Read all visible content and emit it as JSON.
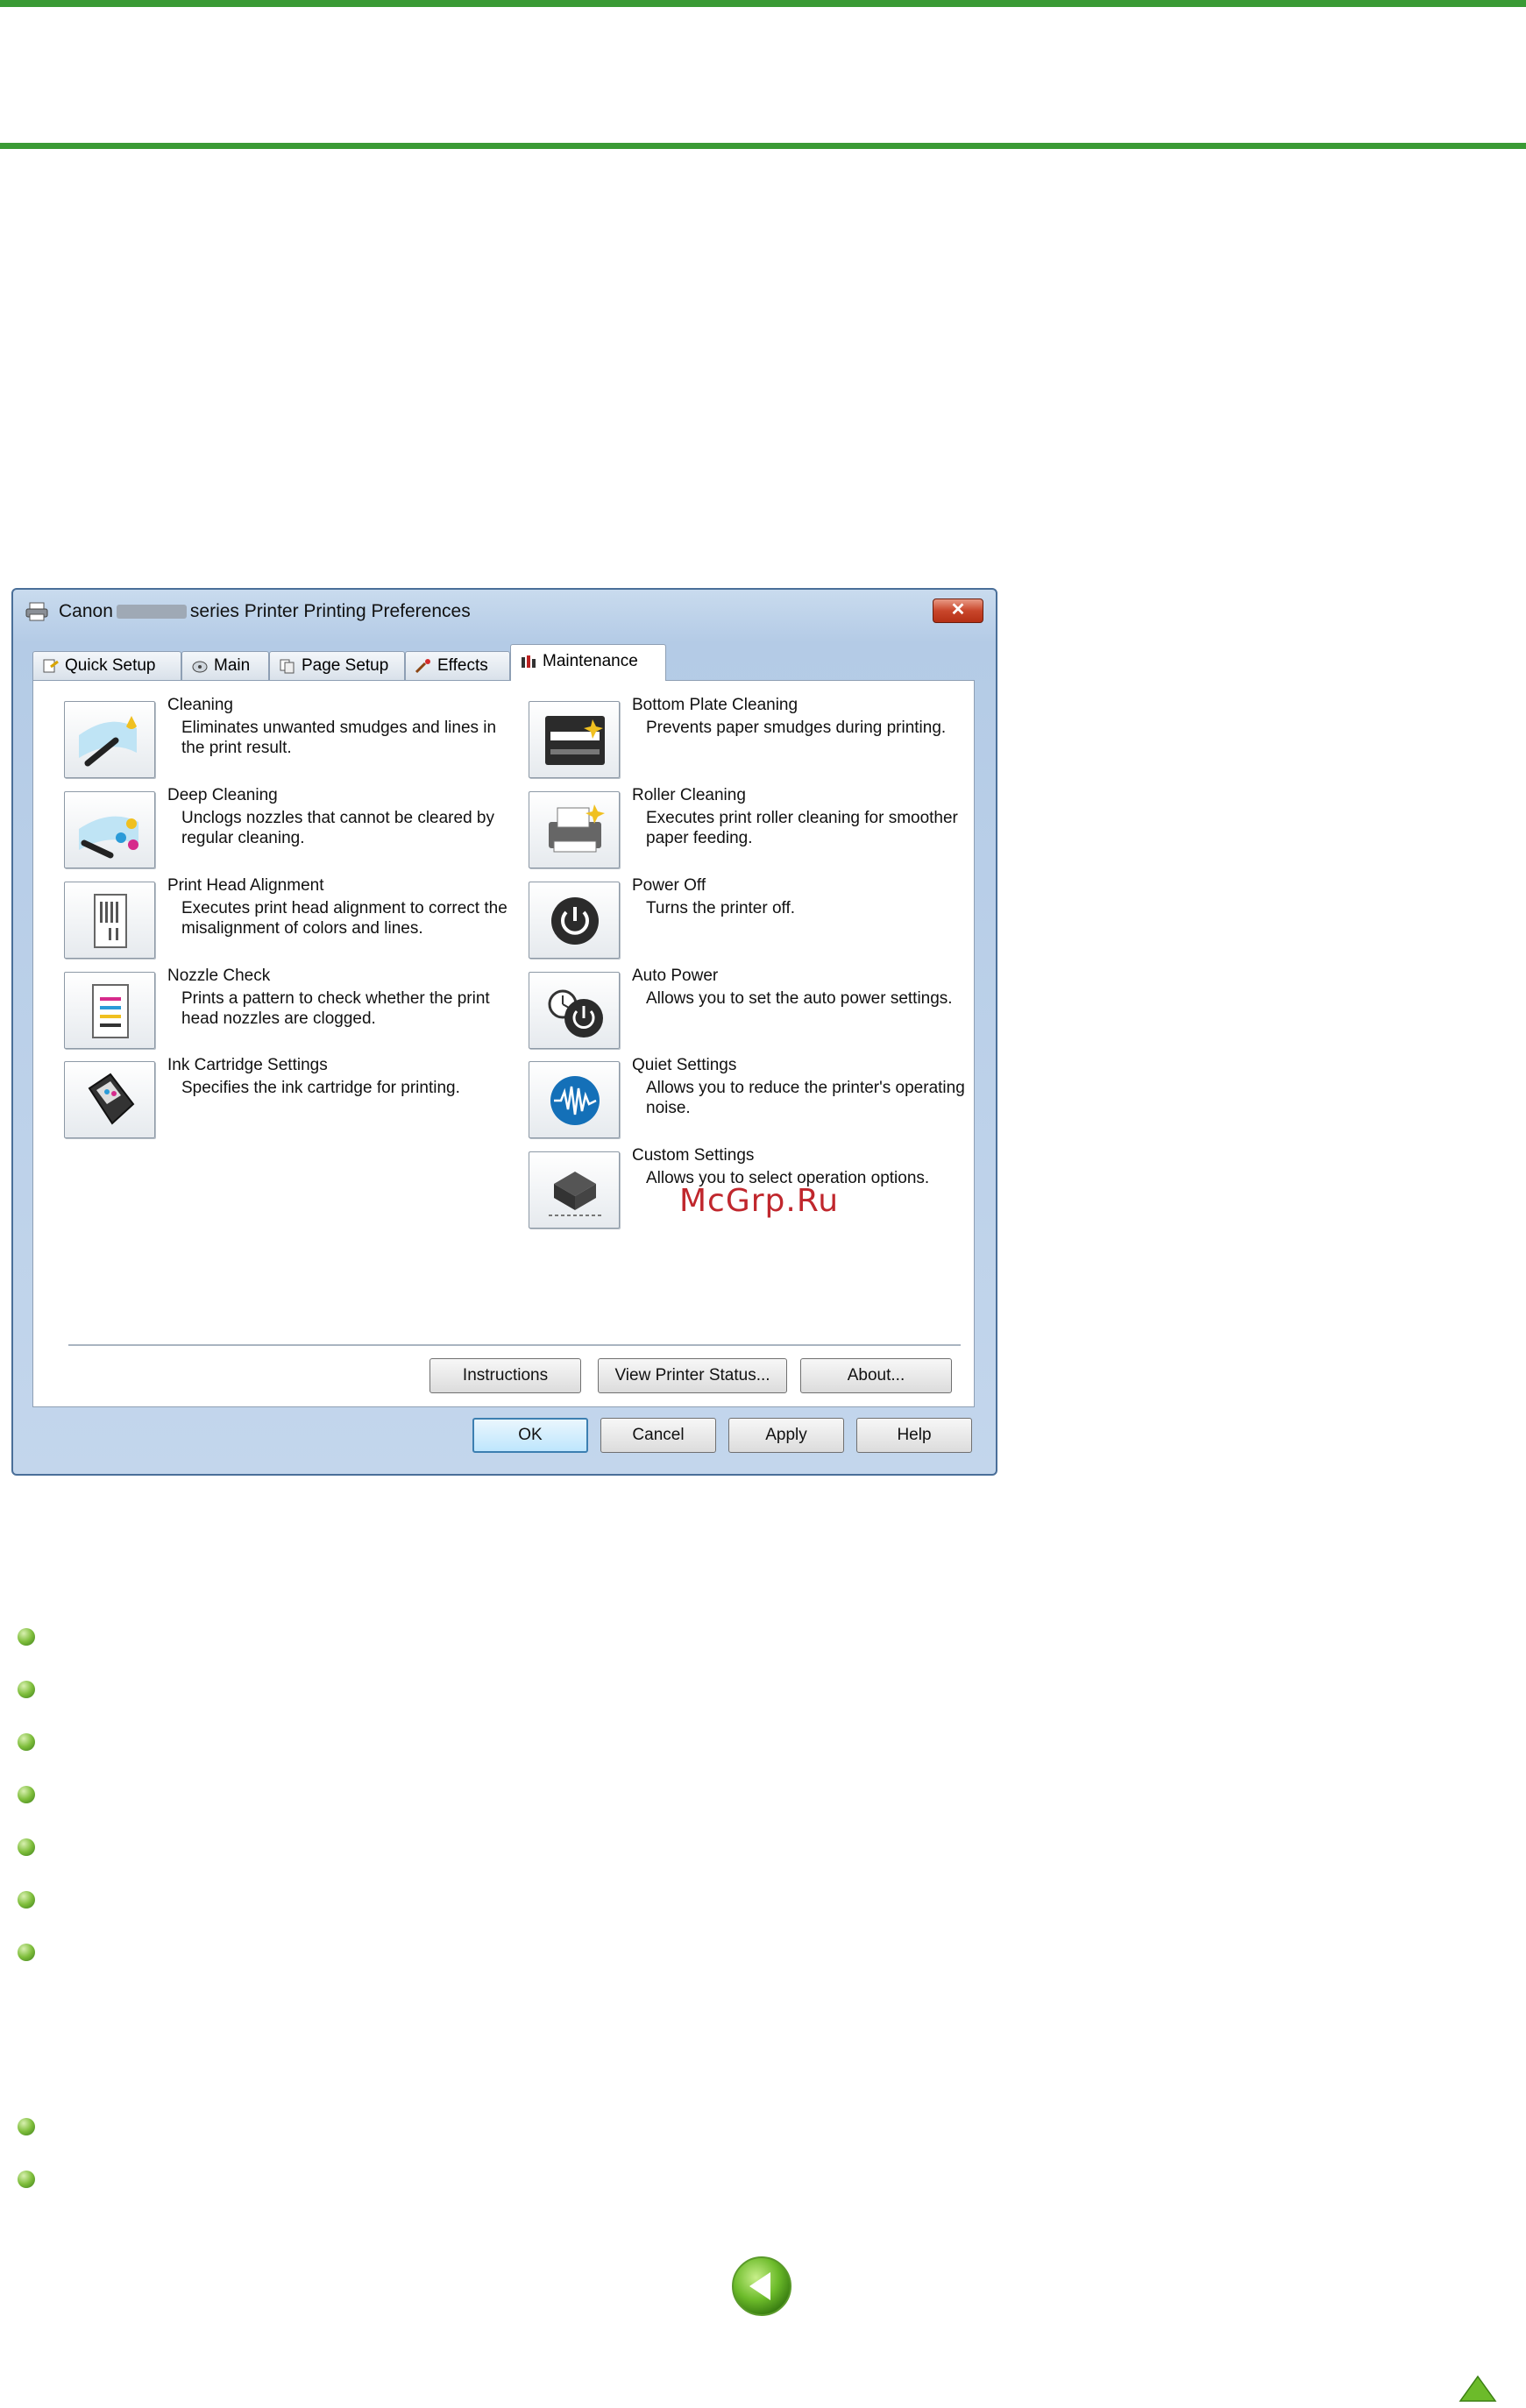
{
  "dialog": {
    "title_prefix": "Canon",
    "title_suffix": "series Printer Printing Preferences",
    "close_glyph": "✕",
    "tabs": [
      {
        "label": "Quick Setup",
        "icon": "quick-setup-icon"
      },
      {
        "label": "Main",
        "icon": "main-icon"
      },
      {
        "label": "Page Setup",
        "icon": "page-setup-icon"
      },
      {
        "label": "Effects",
        "icon": "effects-icon"
      },
      {
        "label": "Maintenance",
        "icon": "maintenance-icon",
        "active": true
      }
    ],
    "left_items": [
      {
        "label": "Cleaning",
        "desc": "Eliminates unwanted smudges and lines in the print result.",
        "icon": "cleaning-icon"
      },
      {
        "label": "Deep Cleaning",
        "desc": "Unclogs nozzles that cannot be cleared by regular cleaning.",
        "icon": "deep-cleaning-icon"
      },
      {
        "label": "Print Head Alignment",
        "desc": "Executes print head alignment to correct the misalignment of colors and lines.",
        "icon": "print-head-alignment-icon"
      },
      {
        "label": "Nozzle Check",
        "desc": "Prints a pattern to check whether the print head nozzles are clogged.",
        "icon": "nozzle-check-icon"
      },
      {
        "label": "Ink Cartridge Settings",
        "desc": "Specifies the ink cartridge for printing.",
        "icon": "ink-cartridge-icon"
      }
    ],
    "right_items": [
      {
        "label": "Bottom Plate Cleaning",
        "desc": "Prevents paper smudges during printing.",
        "icon": "bottom-plate-cleaning-icon"
      },
      {
        "label": "Roller Cleaning",
        "desc": "Executes print roller cleaning for smoother paper feeding.",
        "icon": "roller-cleaning-icon"
      },
      {
        "label": "Power Off",
        "desc": "Turns the printer off.",
        "icon": "power-off-icon"
      },
      {
        "label": "Auto Power",
        "desc": "Allows you to set the auto power settings.",
        "icon": "auto-power-icon"
      },
      {
        "label": "Quiet Settings",
        "desc": "Allows you to reduce the printer's operating noise.",
        "icon": "quiet-settings-icon"
      },
      {
        "label": "Custom Settings",
        "desc": "Allows you to select operation options.",
        "icon": "custom-settings-icon"
      }
    ],
    "buttons": {
      "instructions": "Instructions",
      "view_printer_status": "View Printer Status...",
      "about": "About...",
      "ok": "OK",
      "cancel": "Cancel",
      "apply": "Apply",
      "help": "Help"
    }
  },
  "watermark": "McGrp.Ru",
  "colors": {
    "accent_green": "#3a9a35",
    "watermark_red": "#c0272d"
  }
}
